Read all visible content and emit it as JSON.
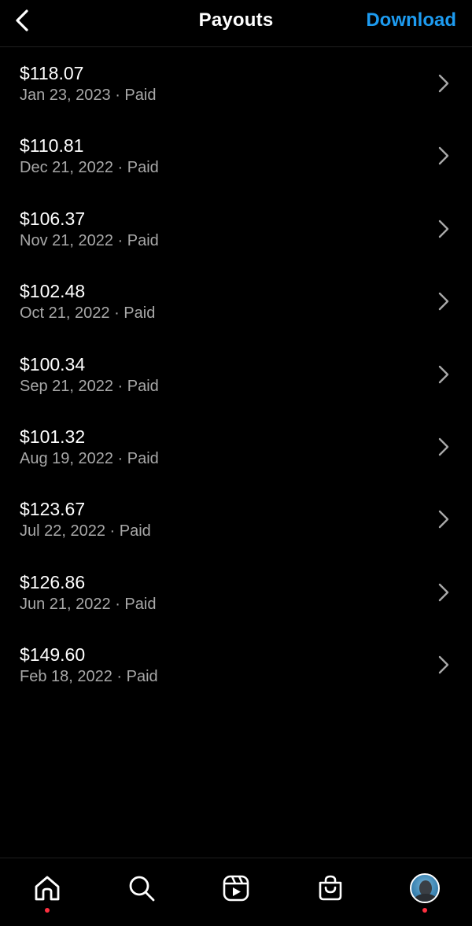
{
  "header": {
    "title": "Payouts",
    "download_label": "Download"
  },
  "payouts": [
    {
      "amount": "$118.07",
      "meta": "Jan 23, 2023 · Paid"
    },
    {
      "amount": "$110.81",
      "meta": "Dec 21, 2022 · Paid"
    },
    {
      "amount": "$106.37",
      "meta": "Nov 21, 2022 · Paid"
    },
    {
      "amount": "$102.48",
      "meta": "Oct 21, 2022 · Paid"
    },
    {
      "amount": "$100.34",
      "meta": "Sep 21, 2022 · Paid"
    },
    {
      "amount": "$101.32",
      "meta": "Aug 19, 2022 · Paid"
    },
    {
      "amount": "$123.67",
      "meta": "Jul 22, 2022 · Paid"
    },
    {
      "amount": "$126.86",
      "meta": "Jun 21, 2022 · Paid"
    },
    {
      "amount": "$149.60",
      "meta": "Feb 18, 2022 · Paid"
    }
  ],
  "tabbar": {
    "tabs": [
      "home-icon",
      "search-icon",
      "reels-icon",
      "shop-icon",
      "profile-avatar"
    ],
    "notification_color": "#ff3040"
  },
  "colors": {
    "background": "#000000",
    "accent": "#1d9bf0",
    "secondary_text": "#a8a8a8"
  }
}
